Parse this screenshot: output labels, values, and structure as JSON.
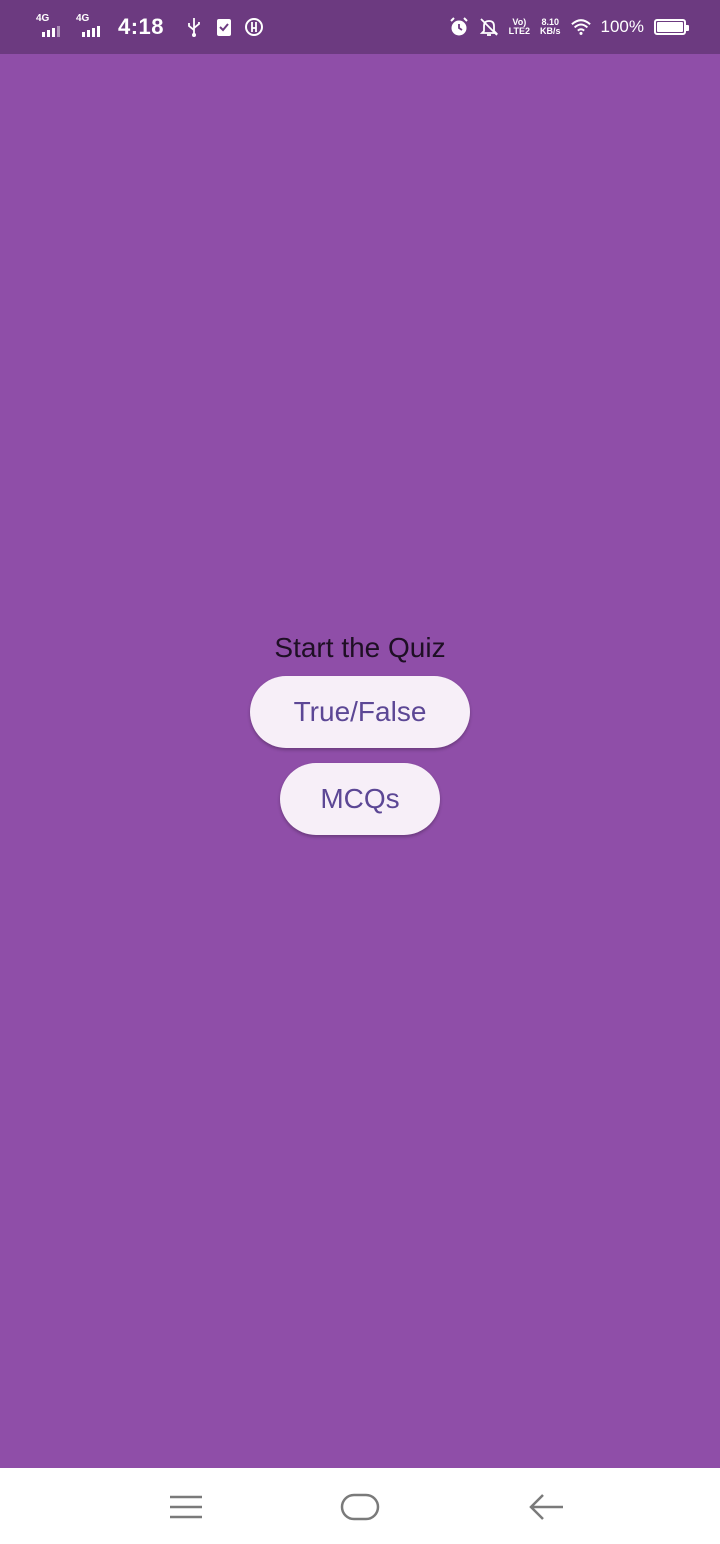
{
  "status_bar": {
    "network1": "4G",
    "network2": "4G",
    "time": "4:18",
    "volte_top": "Vo)",
    "volte_bottom": "LTE2",
    "speed_value": "8.10",
    "speed_unit": "KB/s",
    "battery_percent": "100%"
  },
  "main": {
    "title": "Start the Quiz",
    "buttons": [
      {
        "label": "True/False"
      },
      {
        "label": "MCQs"
      }
    ]
  },
  "colors": {
    "status_bar": "#6c3a80",
    "background": "#8f4ea8",
    "button_bg": "#f7eff8",
    "button_text": "#5c4795",
    "nav_bar": "#ffffff"
  },
  "nav_bar": {
    "icons": [
      "menu-icon",
      "home-icon",
      "back-arrow-icon"
    ]
  }
}
